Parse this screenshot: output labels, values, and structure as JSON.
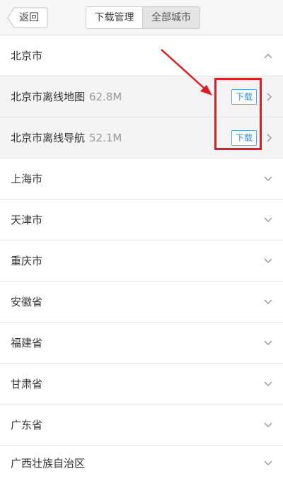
{
  "header": {
    "back_label": "返回",
    "tabs": [
      {
        "label": "下载管理",
        "selected": false
      },
      {
        "label": "全部城市",
        "selected": true
      }
    ]
  },
  "expanded_city": {
    "name": "北京市",
    "items": [
      {
        "name": "北京市离线地图",
        "size": "62.8M",
        "button": "下载"
      },
      {
        "name": "北京市离线导航",
        "size": "52.1M",
        "button": "下载"
      }
    ]
  },
  "cities": [
    "上海市",
    "天津市",
    "重庆市",
    "安徽省",
    "福建省",
    "甘肃省",
    "广东省",
    "广西壮族自治区"
  ],
  "icons": {
    "collapse": "chevron-up-icon",
    "expand": "chevron-down-icon",
    "detail": "chevron-right-icon",
    "back": "back-arrow-icon"
  },
  "colors": {
    "accent": "#2f8fd8",
    "annotation": "#d81f26",
    "header_bg": "#f6f6f6",
    "sub_row_bg": "#f3f3f3"
  }
}
